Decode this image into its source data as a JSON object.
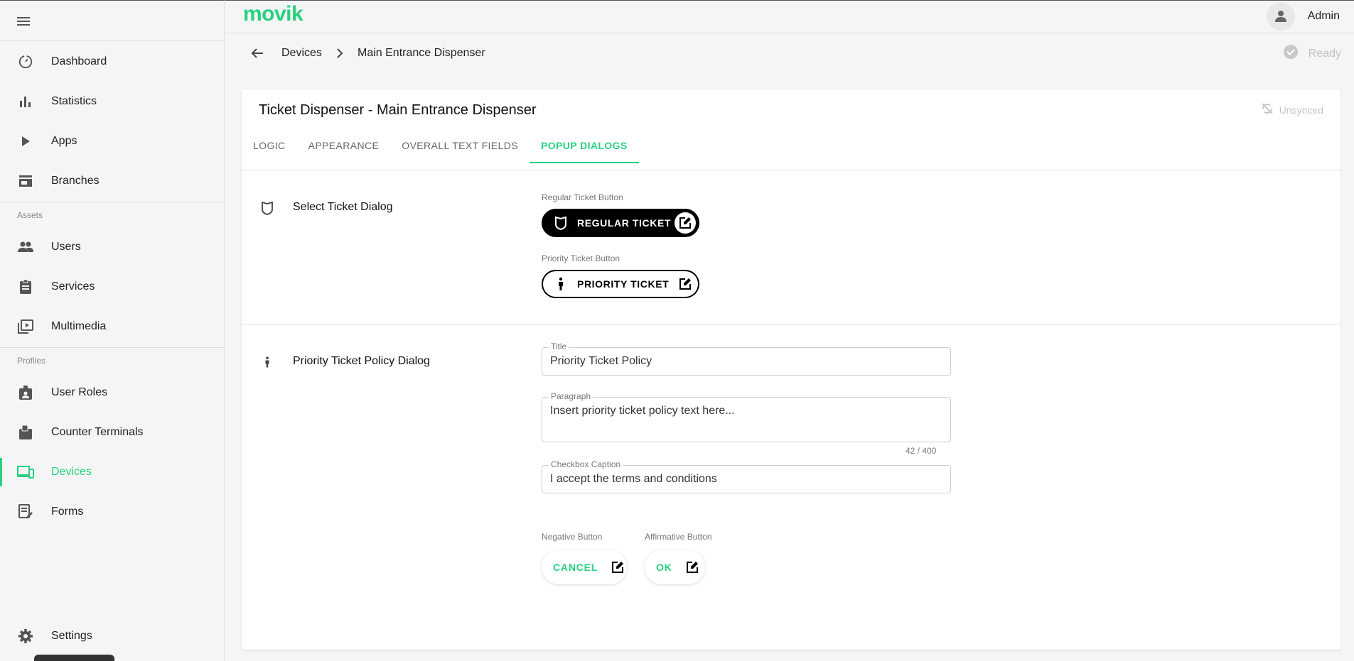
{
  "app": {
    "logo": "movik"
  },
  "topbar": {
    "user_name": "Admin"
  },
  "sidebar": {
    "items": [
      {
        "label": "Dashboard",
        "icon": "dashboard-icon"
      },
      {
        "label": "Statistics",
        "icon": "bar-chart-icon"
      },
      {
        "label": "Apps",
        "icon": "play-icon"
      },
      {
        "label": "Branches",
        "icon": "store-icon"
      },
      {
        "label": "Users",
        "icon": "people-icon"
      },
      {
        "label": "Services",
        "icon": "clipboard-icon"
      },
      {
        "label": "Multimedia",
        "icon": "video-library-icon"
      },
      {
        "label": "User Roles",
        "icon": "badge-icon"
      },
      {
        "label": "Counter Terminals",
        "icon": "terminal-icon"
      },
      {
        "label": "Devices",
        "icon": "devices-icon"
      },
      {
        "label": "Forms",
        "icon": "form-icon"
      },
      {
        "label": "Settings",
        "icon": "gear-icon"
      }
    ],
    "sections": {
      "assets": "Assets",
      "profiles": "Profiles"
    },
    "active": "Devices"
  },
  "breadcrumb": {
    "parent": "Devices",
    "current": "Main Entrance Dispenser"
  },
  "status": {
    "ready": "Ready",
    "sync": "Unsynced"
  },
  "card": {
    "title": "Ticket Dispenser -  Main Entrance Dispenser",
    "tabs": [
      "LOGIC",
      "APPEARANCE",
      "OVERALL TEXT FIELDS",
      "POPUP DIALOGS"
    ],
    "active_tab": "POPUP DIALOGS"
  },
  "select_dialog": {
    "title": "Select Ticket Dialog",
    "regular_caption": "Regular Ticket Button",
    "regular_label": "REGULAR TICKET",
    "priority_caption": "Priority Ticket Button",
    "priority_label": "PRIORITY TICKET"
  },
  "policy_dialog": {
    "title": "Priority Ticket Policy Dialog",
    "title_field": {
      "label": "Title",
      "value": "Priority Ticket Policy"
    },
    "paragraph_field": {
      "label": "Paragraph",
      "value": "Insert priority ticket policy text here...",
      "counter": "42 / 400"
    },
    "checkbox_field": {
      "label": "Checkbox Caption",
      "value": "I accept the terms and conditions"
    },
    "negative_caption": "Negative Button",
    "negative_label": "CANCEL",
    "affirmative_caption": "Affirmative Button",
    "affirmative_label": "OK"
  },
  "colors": {
    "accent": "#27d17f",
    "text": "#222222",
    "muted": "#c2c2c2",
    "dark_button": "#000000"
  }
}
